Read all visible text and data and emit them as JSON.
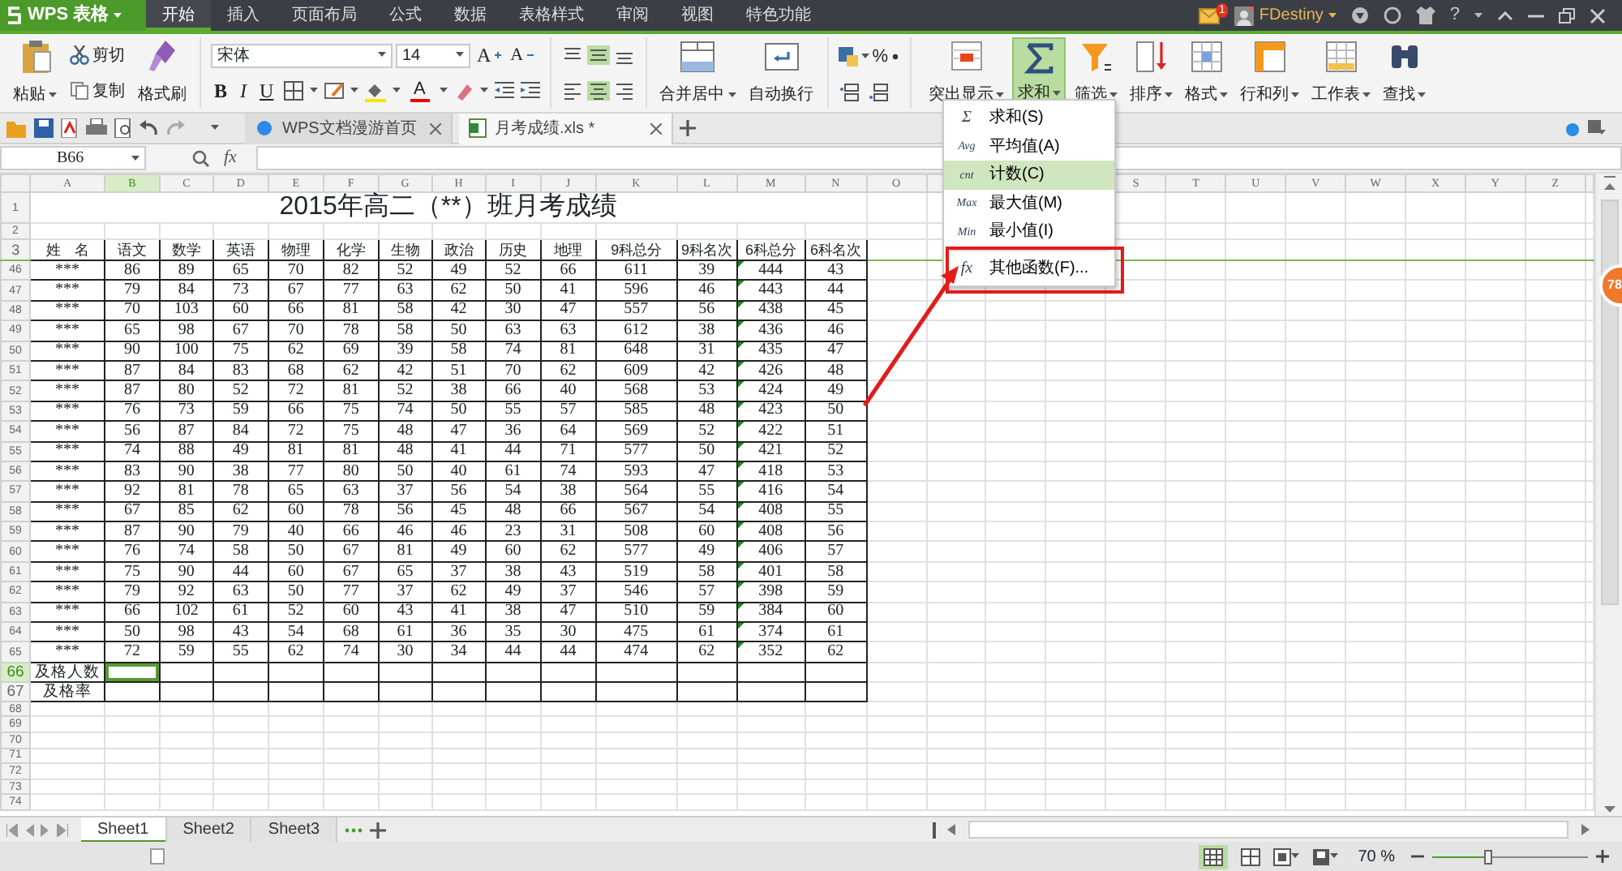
{
  "app": {
    "logo": "WPS 表格"
  },
  "menu_tabs": [
    {
      "label": "开始",
      "selected": true
    },
    {
      "label": "插入",
      "selected": false
    },
    {
      "label": "页面布局",
      "selected": false
    },
    {
      "label": "公式",
      "selected": false
    },
    {
      "label": "数据",
      "selected": false
    },
    {
      "label": "表格样式",
      "selected": false
    },
    {
      "label": "审阅",
      "selected": false
    },
    {
      "label": "视图",
      "selected": false
    },
    {
      "label": "特色功能",
      "selected": false
    }
  ],
  "header_right": {
    "mail_badge": "1",
    "user": "FDestiny",
    "help": "?"
  },
  "ribbon": {
    "clipboard": {
      "paste": "粘贴",
      "cut": "剪切",
      "copy": "复制",
      "format_painter": "格式刷"
    },
    "font": {
      "name": "宋体",
      "size": "14",
      "grow": "A",
      "shrink": "A",
      "bold": "B",
      "italic": "I",
      "underline": "U",
      "font_color": "A"
    },
    "align": {
      "merge": "合并居中",
      "wrap": "自动换行"
    },
    "number": {
      "percent": "%"
    },
    "tools": [
      {
        "kind": "highlight",
        "label": "突出显示",
        "selected": false
      },
      {
        "kind": "sum",
        "label": "求和",
        "selected": true
      },
      {
        "kind": "filter",
        "label": "筛选",
        "selected": false
      },
      {
        "kind": "sort",
        "label": "排序",
        "selected": false
      },
      {
        "kind": "format",
        "label": "格式",
        "selected": false
      },
      {
        "kind": "rowcol",
        "label": "行和列",
        "selected": false
      },
      {
        "kind": "sheet",
        "label": "工作表",
        "selected": false
      },
      {
        "kind": "find",
        "label": "查找",
        "selected": false
      }
    ]
  },
  "doc_tabs": [
    {
      "kind": "home",
      "title": "WPS文档漫游首页",
      "selected": false
    },
    {
      "kind": "sheet",
      "title": "月考成绩.xls *",
      "selected": true
    }
  ],
  "formula_bar": {
    "name_box": "B66",
    "fx": "fx"
  },
  "columns": [
    {
      "letter": "A",
      "selected": false
    },
    {
      "letter": "B",
      "selected": true
    },
    {
      "letter": "C",
      "selected": false
    },
    {
      "letter": "D",
      "selected": false
    },
    {
      "letter": "E",
      "selected": false
    },
    {
      "letter": "F",
      "selected": false
    },
    {
      "letter": "G",
      "selected": false
    },
    {
      "letter": "H",
      "selected": false
    },
    {
      "letter": "I",
      "selected": false
    },
    {
      "letter": "J",
      "selected": false
    },
    {
      "letter": "K",
      "selected": false
    },
    {
      "letter": "L",
      "selected": false
    },
    {
      "letter": "M",
      "selected": false
    },
    {
      "letter": "N",
      "selected": false
    },
    {
      "letter": "O",
      "selected": false
    },
    {},
    {},
    {},
    {
      "letter": "S",
      "selected": false
    },
    {
      "letter": "T",
      "selected": false
    },
    {
      "letter": "U",
      "selected": false
    },
    {
      "letter": "V",
      "selected": false
    },
    {
      "letter": "W",
      "selected": false
    },
    {
      "letter": "X",
      "selected": false
    },
    {
      "letter": "Y",
      "selected": false
    },
    {
      "letter": "Z",
      "selected": false
    }
  ],
  "sheet": {
    "rows": [
      {
        "kind": "title",
        "number": "1",
        "selected": false,
        "title": "2015年高二（**）班月考成绩"
      },
      {
        "kind": "blank",
        "number": "2",
        "selected": false
      },
      {
        "kind": "header",
        "number": "3",
        "selected": false,
        "cells": [
          {
            "text": "姓　名"
          },
          {
            "text": "语文"
          },
          {
            "text": "数学"
          },
          {
            "text": "英语"
          },
          {
            "text": "物理"
          },
          {
            "text": "化学"
          },
          {
            "text": "生物"
          },
          {
            "text": "政治"
          },
          {
            "text": "历史"
          },
          {
            "text": "地理"
          },
          {
            "text": "9科总分"
          },
          {
            "text": "9科名次"
          },
          {
            "text": "6科总分",
            "flagged": true
          },
          {
            "text": "6科名次"
          }
        ]
      },
      {
        "kind": "data",
        "number": "46",
        "selected": false,
        "cells": [
          "***",
          "86",
          "89",
          "65",
          "70",
          "82",
          "52",
          "49",
          "52",
          "66",
          "611",
          "39",
          "444",
          "43"
        ]
      },
      {
        "kind": "data",
        "number": "47",
        "selected": false,
        "cells": [
          "***",
          "79",
          "84",
          "73",
          "67",
          "77",
          "63",
          "62",
          "50",
          "41",
          "596",
          "46",
          "443",
          "44"
        ]
      },
      {
        "kind": "data",
        "number": "48",
        "selected": false,
        "cells": [
          "***",
          "70",
          "103",
          "60",
          "66",
          "81",
          "58",
          "42",
          "30",
          "47",
          "557",
          "56",
          "438",
          "45"
        ]
      },
      {
        "kind": "data",
        "number": "49",
        "selected": false,
        "cells": [
          "***",
          "65",
          "98",
          "67",
          "70",
          "78",
          "58",
          "50",
          "63",
          "63",
          "612",
          "38",
          "436",
          "46"
        ]
      },
      {
        "kind": "data",
        "number": "50",
        "selected": false,
        "cells": [
          "***",
          "90",
          "100",
          "75",
          "62",
          "69",
          "39",
          "58",
          "74",
          "81",
          "648",
          "31",
          "435",
          "47"
        ]
      },
      {
        "kind": "data",
        "number": "51",
        "selected": false,
        "cells": [
          "***",
          "87",
          "84",
          "83",
          "68",
          "62",
          "42",
          "51",
          "70",
          "62",
          "609",
          "42",
          "426",
          "48"
        ]
      },
      {
        "kind": "data",
        "number": "52",
        "selected": false,
        "cells": [
          "***",
          "87",
          "80",
          "52",
          "72",
          "81",
          "52",
          "38",
          "66",
          "40",
          "568",
          "53",
          "424",
          "49"
        ]
      },
      {
        "kind": "data",
        "number": "53",
        "selected": false,
        "cells": [
          "***",
          "76",
          "73",
          "59",
          "66",
          "75",
          "74",
          "50",
          "55",
          "57",
          "585",
          "48",
          "423",
          "50"
        ]
      },
      {
        "kind": "data",
        "number": "54",
        "selected": false,
        "cells": [
          "***",
          "56",
          "87",
          "84",
          "72",
          "75",
          "48",
          "47",
          "36",
          "64",
          "569",
          "52",
          "422",
          "51"
        ]
      },
      {
        "kind": "data",
        "number": "55",
        "selected": false,
        "cells": [
          "***",
          "74",
          "88",
          "49",
          "81",
          "81",
          "48",
          "41",
          "44",
          "71",
          "577",
          "50",
          "421",
          "52"
        ]
      },
      {
        "kind": "data",
        "number": "56",
        "selected": false,
        "cells": [
          "***",
          "83",
          "90",
          "38",
          "77",
          "80",
          "50",
          "40",
          "61",
          "74",
          "593",
          "47",
          "418",
          "53"
        ]
      },
      {
        "kind": "data",
        "number": "57",
        "selected": false,
        "cells": [
          "***",
          "92",
          "81",
          "78",
          "65",
          "63",
          "37",
          "56",
          "54",
          "38",
          "564",
          "55",
          "416",
          "54"
        ]
      },
      {
        "kind": "data",
        "number": "58",
        "selected": false,
        "cells": [
          "***",
          "67",
          "85",
          "62",
          "60",
          "78",
          "56",
          "45",
          "48",
          "66",
          "567",
          "54",
          "408",
          "55"
        ]
      },
      {
        "kind": "data",
        "number": "59",
        "selected": false,
        "cells": [
          "***",
          "87",
          "90",
          "79",
          "40",
          "66",
          "46",
          "46",
          "23",
          "31",
          "508",
          "60",
          "408",
          "56"
        ]
      },
      {
        "kind": "data",
        "number": "60",
        "selected": false,
        "cells": [
          "***",
          "76",
          "74",
          "58",
          "50",
          "67",
          "81",
          "49",
          "60",
          "62",
          "577",
          "49",
          "406",
          "57"
        ]
      },
      {
        "kind": "data",
        "number": "61",
        "selected": false,
        "cells": [
          "***",
          "75",
          "90",
          "44",
          "60",
          "67",
          "65",
          "37",
          "38",
          "43",
          "519",
          "58",
          "401",
          "58"
        ]
      },
      {
        "kind": "data",
        "number": "62",
        "selected": false,
        "cells": [
          "***",
          "79",
          "92",
          "63",
          "50",
          "77",
          "37",
          "62",
          "49",
          "37",
          "546",
          "57",
          "398",
          "59"
        ]
      },
      {
        "kind": "data",
        "number": "63",
        "selected": false,
        "cells": [
          "***",
          "66",
          "102",
          "61",
          "52",
          "60",
          "43",
          "41",
          "38",
          "47",
          "510",
          "59",
          "384",
          "60"
        ]
      },
      {
        "kind": "data",
        "number": "64",
        "selected": false,
        "cells": [
          "***",
          "50",
          "98",
          "43",
          "54",
          "68",
          "61",
          "36",
          "35",
          "30",
          "475",
          "61",
          "374",
          "61"
        ]
      },
      {
        "kind": "data",
        "number": "65",
        "selected": false,
        "cells": [
          "***",
          "72",
          "59",
          "55",
          "62",
          "74",
          "30",
          "34",
          "44",
          "44",
          "474",
          "62",
          "352",
          "62"
        ]
      },
      {
        "kind": "summary",
        "number": "66",
        "selected": true,
        "label": "及格人数"
      },
      {
        "kind": "summary",
        "number": "67",
        "selected": false,
        "label": "及格率"
      },
      {
        "kind": "empty",
        "number": "68",
        "selected": false
      },
      {
        "kind": "empty",
        "number": "69",
        "selected": false
      },
      {
        "kind": "empty",
        "number": "70",
        "selected": false
      },
      {
        "kind": "empty",
        "number": "71",
        "selected": false
      },
      {
        "kind": "empty",
        "number": "72",
        "selected": false
      },
      {
        "kind": "empty",
        "number": "73",
        "selected": false
      },
      {
        "kind": "empty",
        "number": "74",
        "selected": false
      }
    ]
  },
  "sum_menu": {
    "items": [
      {
        "kind": "item",
        "icon_text": "Σ",
        "label": "求和(S)",
        "selected": false,
        "boxed": false
      },
      {
        "kind": "item",
        "icon_text": "Avg",
        "label": "平均值(A)",
        "selected": false,
        "boxed": false
      },
      {
        "kind": "item",
        "icon_text": "cnt",
        "label": "计数(C)",
        "selected": true,
        "boxed": false
      },
      {
        "kind": "item",
        "icon_text": "Max",
        "label": "最大值(M)",
        "selected": false,
        "boxed": false
      },
      {
        "kind": "item",
        "icon_text": "Min",
        "label": "最小值(I)",
        "selected": false,
        "boxed": false
      },
      {
        "kind": "separator"
      },
      {
        "kind": "item",
        "icon_text": "fx",
        "label": "其他函数(F)...",
        "selected": false,
        "boxed": true
      }
    ]
  },
  "float_badge": "78",
  "sheet_tabs": [
    {
      "label": "Sheet1",
      "selected": true
    },
    {
      "label": "Sheet2",
      "selected": false
    },
    {
      "label": "Sheet3",
      "selected": false
    }
  ],
  "status_bar": {
    "zoom": "70 %",
    "zoom_slider": {
      "level": 0.35
    }
  }
}
